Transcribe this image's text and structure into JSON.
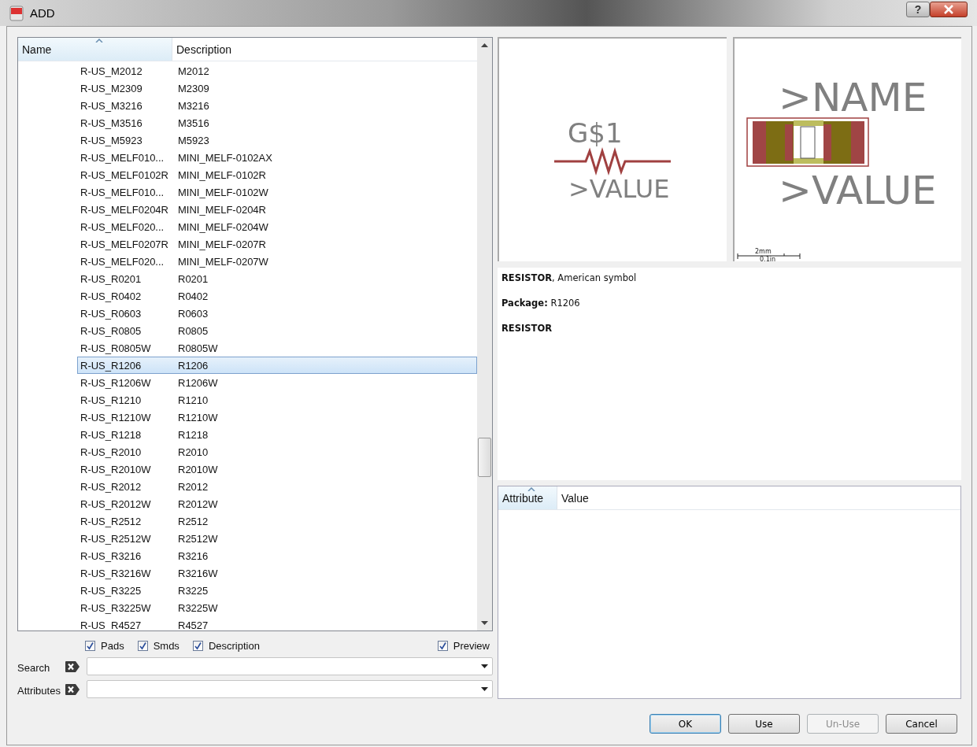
{
  "window": {
    "title": "ADD",
    "help": "?"
  },
  "list": {
    "columns": [
      {
        "label": "Name",
        "sorted": true
      },
      {
        "label": "Description",
        "sorted": false
      }
    ],
    "rows": [
      {
        "name": "R-US_M2012",
        "description": "M2012",
        "selected": false
      },
      {
        "name": "R-US_M2309",
        "description": "M2309",
        "selected": false
      },
      {
        "name": "R-US_M3216",
        "description": "M3216",
        "selected": false
      },
      {
        "name": "R-US_M3516",
        "description": "M3516",
        "selected": false
      },
      {
        "name": "R-US_M5923",
        "description": "M5923",
        "selected": false
      },
      {
        "name": "R-US_MELF010...",
        "description": "MINI_MELF-0102AX",
        "selected": false
      },
      {
        "name": "R-US_MELF0102R",
        "description": "MINI_MELF-0102R",
        "selected": false
      },
      {
        "name": "R-US_MELF010...",
        "description": "MINI_MELF-0102W",
        "selected": false
      },
      {
        "name": "R-US_MELF0204R",
        "description": "MINI_MELF-0204R",
        "selected": false
      },
      {
        "name": "R-US_MELF020...",
        "description": "MINI_MELF-0204W",
        "selected": false
      },
      {
        "name": "R-US_MELF0207R",
        "description": "MINI_MELF-0207R",
        "selected": false
      },
      {
        "name": "R-US_MELF020...",
        "description": "MINI_MELF-0207W",
        "selected": false
      },
      {
        "name": "R-US_R0201",
        "description": "R0201",
        "selected": false
      },
      {
        "name": "R-US_R0402",
        "description": "R0402",
        "selected": false
      },
      {
        "name": "R-US_R0603",
        "description": "R0603",
        "selected": false
      },
      {
        "name": "R-US_R0805",
        "description": "R0805",
        "selected": false
      },
      {
        "name": "R-US_R0805W",
        "description": "R0805W",
        "selected": false
      },
      {
        "name": "R-US_R1206",
        "description": "R1206",
        "selected": true
      },
      {
        "name": "R-US_R1206W",
        "description": "R1206W",
        "selected": false
      },
      {
        "name": "R-US_R1210",
        "description": "R1210",
        "selected": false
      },
      {
        "name": "R-US_R1210W",
        "description": "R1210W",
        "selected": false
      },
      {
        "name": "R-US_R1218",
        "description": "R1218",
        "selected": false
      },
      {
        "name": "R-US_R2010",
        "description": "R2010",
        "selected": false
      },
      {
        "name": "R-US_R2010W",
        "description": "R2010W",
        "selected": false
      },
      {
        "name": "R-US_R2012",
        "description": "R2012",
        "selected": false
      },
      {
        "name": "R-US_R2012W",
        "description": "R2012W",
        "selected": false
      },
      {
        "name": "R-US_R2512",
        "description": "R2512",
        "selected": false
      },
      {
        "name": "R-US_R2512W",
        "description": "R2512W",
        "selected": false
      },
      {
        "name": "R-US_R3216",
        "description": "R3216",
        "selected": false
      },
      {
        "name": "R-US_R3216W",
        "description": "R3216W",
        "selected": false
      },
      {
        "name": "R-US_R3225",
        "description": "R3225",
        "selected": false
      },
      {
        "name": "R-US_R3225W",
        "description": "R3225W",
        "selected": false
      },
      {
        "name": "R-US_R4527",
        "description": "R4527",
        "selected": false
      }
    ]
  },
  "filters": [
    {
      "label": "Pads",
      "checked": true
    },
    {
      "label": "Smds",
      "checked": true
    },
    {
      "label": "Description",
      "checked": true
    }
  ],
  "preview_toggle": {
    "label": "Preview",
    "checked": true
  },
  "fields": [
    {
      "label": "Search"
    },
    {
      "label": "Attributes"
    }
  ],
  "symbol_preview": {
    "name": "G$1",
    "value": ">VALUE"
  },
  "package_preview": {
    "name": ">NAME",
    "value": ">VALUE",
    "scale_mm": "2mm",
    "scale_in": "0.1in"
  },
  "description": [
    {
      "text": "**RESISTOR**, American symbol",
      "bold": false
    },
    {
      "text": "**Package:** R1206",
      "bold": false
    },
    {
      "text": "RESISTOR",
      "bold": true
    }
  ],
  "attributes": {
    "columns": [
      {
        "label": "Attribute",
        "sorted": true
      },
      {
        "label": "Value",
        "sorted": false
      }
    ]
  },
  "buttons": [
    {
      "label": "OK",
      "default": true,
      "disabled": false
    },
    {
      "label": "Use",
      "default": false,
      "disabled": false
    },
    {
      "label": "Un-Use",
      "default": false,
      "disabled": true
    },
    {
      "label": "Cancel",
      "default": false,
      "disabled": false
    }
  ]
}
